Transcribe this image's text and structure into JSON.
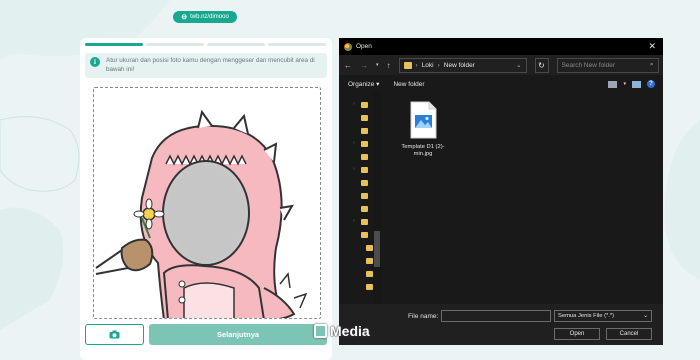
{
  "url_pill": {
    "icon": "link-icon",
    "text": "twb.nz/dimooo"
  },
  "card": {
    "progress": [
      true,
      false,
      false,
      false
    ],
    "info_text": "Atur ukuran dan posisi foto kamu dengan menggeser dan mencubit area di bawah ini!",
    "camera_icon": "camera-icon",
    "next_label": "Selanjutnya"
  },
  "dialog": {
    "title": "Open",
    "close": "✕",
    "path": [
      "Loki",
      "New folder"
    ],
    "path_separator": "›",
    "search_placeholder": "Search New folder",
    "organize_label": "Organize ▾",
    "new_folder_label": "New folder",
    "file": {
      "name": "Template D1 (2)-min.jpg"
    },
    "filename_label": "File name:",
    "filetype_value": "Semua Jenis File (*.*)",
    "open_label": "Open",
    "cancel_label": "Cancel"
  },
  "watermark": {
    "text": "Media"
  },
  "colors": {
    "accent": "#17a88f",
    "dialog_bg": "#202020",
    "page_bg": "#eaf4f4"
  }
}
